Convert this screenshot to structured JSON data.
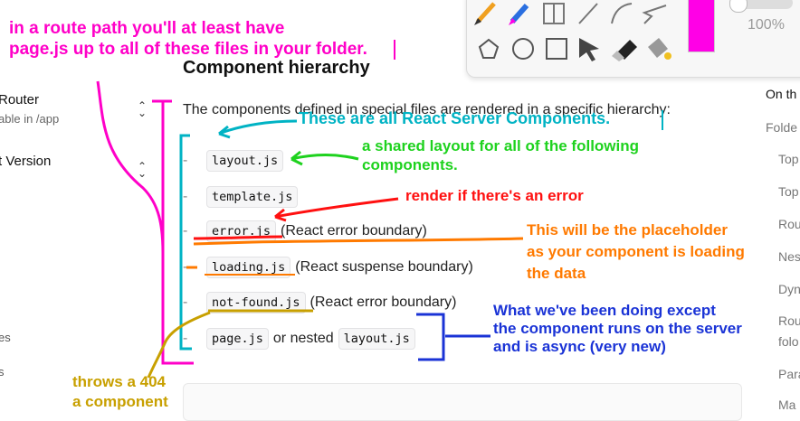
{
  "sidebar": {
    "title": "Router",
    "subtitle": "able in /app",
    "version": "t Version",
    "item_es": "es",
    "item_s": "s"
  },
  "doc": {
    "heading": "Component hierarchy",
    "intro": "The components defined in special files are rendered in a specific hierarchy:",
    "items": [
      {
        "code": "layout.js",
        "text": ""
      },
      {
        "code": "template.js",
        "text": ""
      },
      {
        "code": "error.js",
        "text": "(React error boundary)"
      },
      {
        "code": "loading.js",
        "text": "(React suspense boundary)"
      },
      {
        "code": "not-found.js",
        "text": "(React error boundary)"
      },
      {
        "code": "page.js",
        "text": "or nested",
        "code2": "layout.js"
      }
    ]
  },
  "toc": {
    "heading": "On th",
    "items": [
      "Folde",
      "Top",
      "Top",
      "Rou",
      "Nes",
      "Dyn",
      "Rou",
      "folo",
      "Para",
      "Ma"
    ]
  },
  "toolbar": {
    "opacity": "100%",
    "accent": "#ff00e6",
    "tools": [
      "pencil-icon",
      "marker-icon",
      "highlighter-icon",
      "line-icon",
      "curve-icon",
      "freeform-icon",
      "polygon-icon",
      "circle-icon",
      "square-icon",
      "pointer-icon",
      "eraser-icon",
      "fill-icon"
    ]
  },
  "annotations": {
    "top_line1": "in a route path you'll at least have",
    "top_line2": "page.js up to all of these files in your folder.",
    "rsc": "These are all React Server Components.",
    "shared_line1": "a shared layout for all of the following",
    "shared_line2": "components.",
    "error": "render if there's an error",
    "loading_line1": "This will be the placeholder",
    "loading_line2": "as your component is loading",
    "loading_line3": "the data",
    "page_line1": "What we've been doing except",
    "page_line2": "the component runs on the server",
    "page_line3": "and is async (very new)",
    "notfound_line1": "throws a 404",
    "notfound_line2": "a component"
  }
}
